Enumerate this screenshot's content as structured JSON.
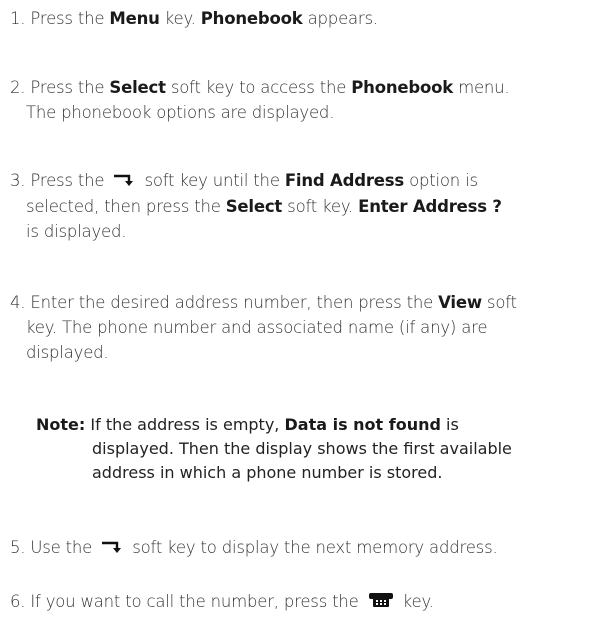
{
  "steps": {
    "s1": {
      "num": "1.",
      "pre": "Press the",
      "b1": "Menu",
      "mid": "key.",
      "b2": "Phonebook",
      "post": "appears."
    },
    "s2": {
      "num": "2.",
      "pre": "Press the",
      "b1": "Select",
      "mid": "soft key to access the",
      "b2": "Phonebook",
      "post": "menu.",
      "line2": "The phonebook options are displayed."
    },
    "s3": {
      "num": "3.",
      "pre": "Press the",
      "icon": "down-arrow-soft-key-icon",
      "mid1": "soft key until the",
      "b1": "Find Address",
      "post1": "option is",
      "line2pre": "selected, then press the",
      "b2": "Select",
      "mid2": "soft key.",
      "b3": "Enter Address ?",
      "line3": "is displayed."
    },
    "s4": {
      "num": "4.",
      "pre": "Enter the desired address number, then press the",
      "b1": "View",
      "post": "soft",
      "line2": "key. The phone number and associated name (if any) are",
      "line3": "displayed."
    },
    "note": {
      "label": "Note:",
      "pre": "If the address is empty,",
      "b1": "Data is not found",
      "post": "is",
      "line2": "displayed. Then the display shows the first available",
      "line3": "address in which a phone number is stored."
    },
    "s5": {
      "num": "5.",
      "pre": "Use the",
      "icon": "down-arrow-soft-key-icon",
      "post": "soft key to display the next memory address."
    },
    "s6": {
      "num": "6.",
      "pre": "If you want to call the number, press the",
      "icon": "send-phone-key-icon",
      "post": "key."
    }
  },
  "colors": {
    "text": "#333333",
    "bold": "#1a1a1a"
  }
}
